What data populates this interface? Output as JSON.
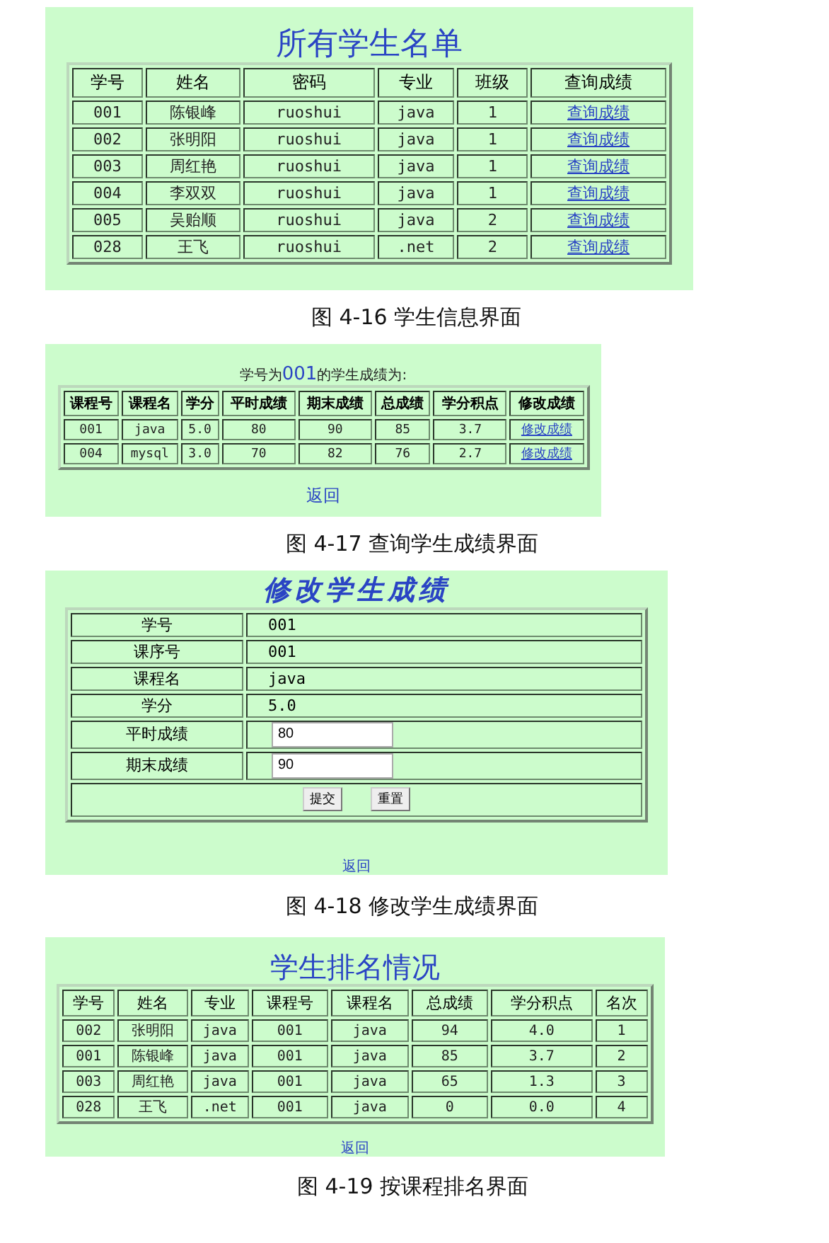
{
  "student_list": {
    "title": "所有学生名单",
    "columns": [
      "学号",
      "姓名",
      "密码",
      "专业",
      "班级",
      "查询成绩"
    ],
    "rows": [
      {
        "cells": [
          "001",
          "陈银峰",
          "ruoshui",
          "java",
          "1"
        ],
        "link": "查询成绩"
      },
      {
        "cells": [
          "002",
          "张明阳",
          "ruoshui",
          "java",
          "1"
        ],
        "link": "查询成绩"
      },
      {
        "cells": [
          "003",
          "周红艳",
          "ruoshui",
          "java",
          "1"
        ],
        "link": "查询成绩"
      },
      {
        "cells": [
          "004",
          "李双双",
          "ruoshui",
          "java",
          "1"
        ],
        "link": "查询成绩"
      },
      {
        "cells": [
          "005",
          "吴贻顺",
          "ruoshui",
          "java",
          "2"
        ],
        "link": "查询成绩"
      },
      {
        "cells": [
          "028",
          "王飞",
          "ruoshui",
          ".net",
          "2"
        ],
        "link": "查询成绩"
      }
    ],
    "caption": "图 4-16 学生信息界面"
  },
  "score_query": {
    "heading_before": "学号为",
    "student_id": "001",
    "heading_after": "的学生成绩为:",
    "columns": [
      "课程号",
      "课程名",
      "学分",
      "平时成绩",
      "期末成绩",
      "总成绩",
      "学分积点",
      "修改成绩"
    ],
    "rows": [
      {
        "cells": [
          "001",
          "java",
          "5.0",
          "80",
          "90",
          "85",
          "3.7"
        ],
        "link": "修改成绩"
      },
      {
        "cells": [
          "004",
          "mysql",
          "3.0",
          "70",
          "82",
          "76",
          "2.7"
        ],
        "link": "修改成绩"
      }
    ],
    "back": "返回",
    "caption": "图 4-17 查询学生成绩界面"
  },
  "score_edit": {
    "title": "修改学生成绩",
    "fields": [
      {
        "kind": "text",
        "label": "学号",
        "value": "001"
      },
      {
        "kind": "text",
        "label": "课序号",
        "value": "001"
      },
      {
        "kind": "text",
        "label": "课程名",
        "value": "java"
      },
      {
        "kind": "text",
        "label": "学分",
        "value": "5.0"
      },
      {
        "kind": "input",
        "label": "平时成绩",
        "value": "80"
      },
      {
        "kind": "input",
        "label": "期末成绩",
        "value": "90"
      }
    ],
    "buttons": [
      "提交",
      "重置"
    ],
    "back": "返回",
    "caption": "图 4-18 修改学生成绩界面"
  },
  "ranking": {
    "title": "学生排名情况",
    "columns": [
      "学号",
      "姓名",
      "专业",
      "课程号",
      "课程名",
      "总成绩",
      "学分积点",
      "名次"
    ],
    "rows": [
      {
        "cells": [
          "002",
          "张明阳",
          "java",
          "001",
          "java",
          "94",
          "4.0",
          "1"
        ]
      },
      {
        "cells": [
          "001",
          "陈银峰",
          "java",
          "001",
          "java",
          "85",
          "3.7",
          "2"
        ]
      },
      {
        "cells": [
          "003",
          "周红艳",
          "java",
          "001",
          "java",
          "65",
          "1.3",
          "3"
        ]
      },
      {
        "cells": [
          "028",
          "王飞",
          ".net",
          "001",
          "java",
          "0",
          "0.0",
          "4"
        ]
      }
    ],
    "back": "返回",
    "caption": "图 4-19 按课程排名界面"
  }
}
